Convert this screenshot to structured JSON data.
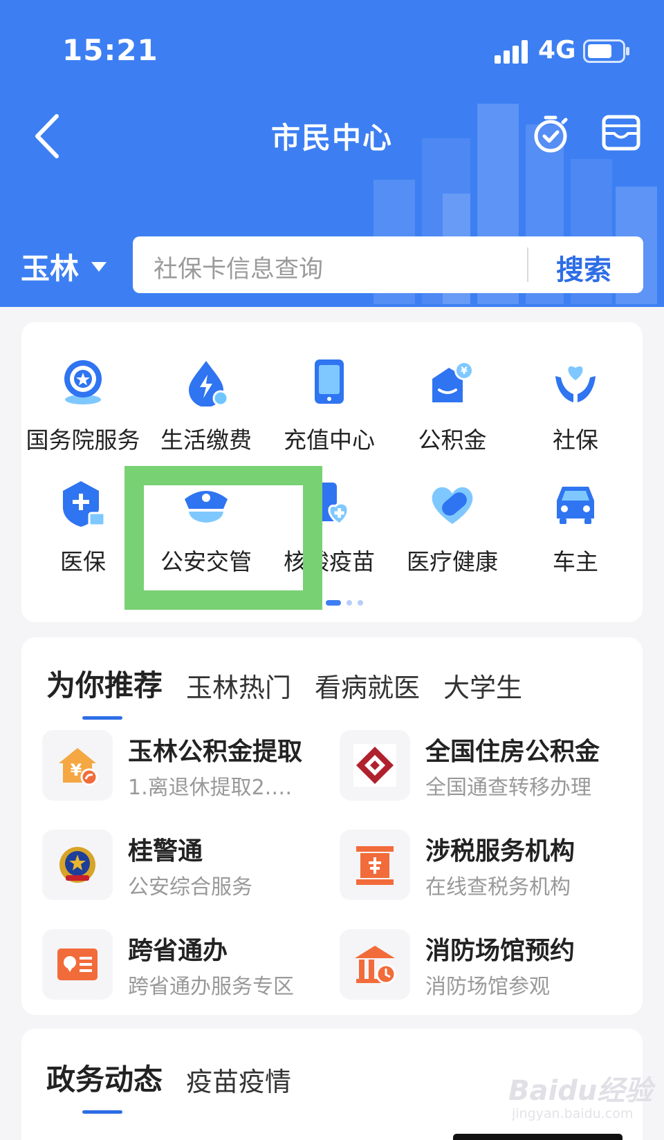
{
  "status_bar": {
    "time": "15:21",
    "network": "4G"
  },
  "nav": {
    "title": "市民中心",
    "back_icon": "chevron-left-icon",
    "timer_icon": "stopwatch-icon",
    "card_icon": "card-holder-icon"
  },
  "location": {
    "city": "玉林"
  },
  "search": {
    "placeholder": "社保卡信息查询",
    "button": "搜索"
  },
  "services": [
    {
      "label": "国务院服务",
      "icon": "state-council-icon"
    },
    {
      "label": "生活缴费",
      "icon": "utility-drop-icon"
    },
    {
      "label": "充值中心",
      "icon": "phone-topup-icon"
    },
    {
      "label": "公积金",
      "icon": "housing-fund-icon"
    },
    {
      "label": "社保",
      "icon": "social-security-icon"
    },
    {
      "label": "医保",
      "icon": "medical-insurance-icon"
    },
    {
      "label": "公安交管",
      "icon": "police-cap-icon"
    },
    {
      "label": "核酸疫苗",
      "icon": "vaccine-icon"
    },
    {
      "label": "医疗健康",
      "icon": "health-heart-icon"
    },
    {
      "label": "车主",
      "icon": "car-icon"
    }
  ],
  "recommend": {
    "tabs": [
      "为你推荐",
      "玉林热门",
      "看病就医",
      "大学生"
    ],
    "items": [
      {
        "title": "玉林公积金提取",
        "subtitle": "1.离退休提取2.租...",
        "icon": "fund-withdraw-icon"
      },
      {
        "title": "全国住房公积金",
        "subtitle": "全国通查转移办理",
        "icon": "national-housing-fund-icon"
      },
      {
        "title": "桂警通",
        "subtitle": "公安综合服务",
        "icon": "police-emblem-icon"
      },
      {
        "title": "涉税服务机构",
        "subtitle": "在线查税务机构",
        "icon": "tax-office-icon"
      },
      {
        "title": "跨省通办",
        "subtitle": "跨省通办服务专区",
        "icon": "id-card-icon"
      },
      {
        "title": "消防场馆预约",
        "subtitle": "消防场馆参观",
        "icon": "fire-venue-icon"
      }
    ]
  },
  "news": {
    "tabs": [
      "政务动态",
      "疫苗疫情"
    ]
  },
  "watermark": {
    "brand": "Baidu经验",
    "url": "jingyan.baidu.com"
  },
  "colors": {
    "primary": "#3d7ff2",
    "highlight": "#78d173",
    "accent": "#2e6de5",
    "orange": "#f26b3a"
  }
}
